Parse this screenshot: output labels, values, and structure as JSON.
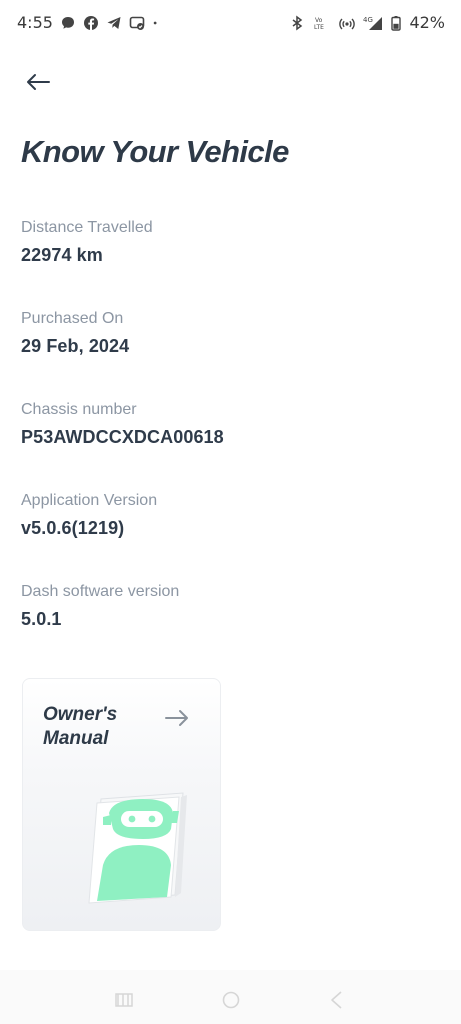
{
  "status_bar": {
    "time": "4:55",
    "battery": "42%",
    "left_icons": [
      "chat-bubble-icon",
      "facebook-icon",
      "telegram-icon",
      "messenger-icon",
      "dot-icon"
    ],
    "right_icons": [
      "bluetooth-icon",
      "volte-icon",
      "hotspot-icon",
      "signal-4g-icon",
      "battery-icon"
    ],
    "volte_text": "Vo LTE",
    "network_text": "4G"
  },
  "header": {
    "title": "Know Your Vehicle"
  },
  "fields": [
    {
      "label": "Distance Travelled",
      "value": "22974 km"
    },
    {
      "label": "Purchased On",
      "value": "29 Feb, 2024"
    },
    {
      "label": "Chassis number",
      "value": "P53AWDCCXDCA00618"
    },
    {
      "label": "Application Version",
      "value": "v5.0.6(1219)"
    },
    {
      "label": "Dash software version",
      "value": "5.0.1"
    }
  ],
  "owners_manual_card": {
    "line1": "Owner's",
    "line2": "Manual",
    "accent_color": "#8ff0c2"
  },
  "nav_bar": {
    "icons": [
      "recents-icon",
      "home-icon",
      "back-nav-icon"
    ]
  }
}
